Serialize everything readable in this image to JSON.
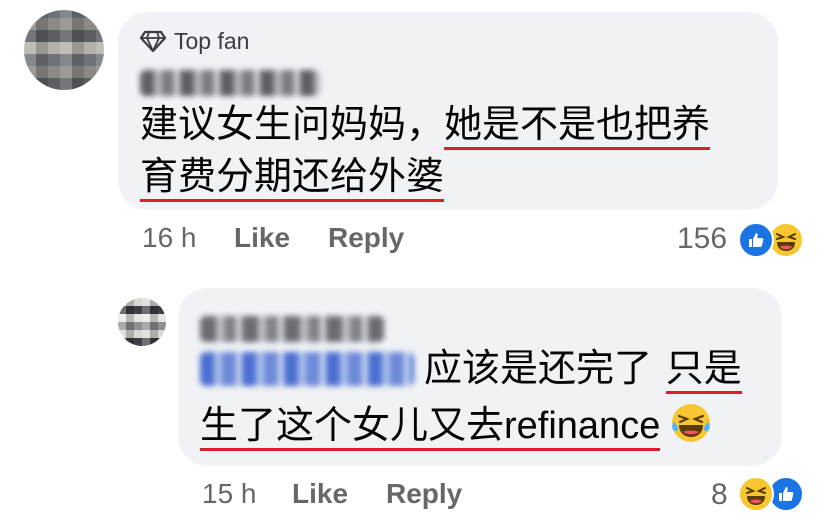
{
  "comment": {
    "badge": "Top fan",
    "text_line1_plain": "建议女生问妈妈，",
    "text_line1_underlined": "她是不是也把养",
    "text_line2_underlined": "育费分期还给外婆",
    "time": "16 h",
    "like_label": "Like",
    "reply_label": "Reply",
    "reaction_count": "156",
    "reactions": [
      "like-reaction",
      "haha-reaction"
    ]
  },
  "reply": {
    "text_line1_plain": "应该是还完了",
    "text_line1_underlined": "只是",
    "text_line2_underlined": "生了这个女儿又去refinance",
    "inline_emoji": "laughing-with-tears",
    "time": "15 h",
    "like_label": "Like",
    "reply_label": "Reply",
    "reaction_count": "8",
    "reactions": [
      "haha-reaction",
      "like-reaction"
    ]
  },
  "colors": {
    "bubble": "#f0f2f5",
    "meta_text": "#65676b",
    "underline": "#d9202f",
    "like_blue": "#1b74e4",
    "haha_yellow": "#f7c631"
  }
}
